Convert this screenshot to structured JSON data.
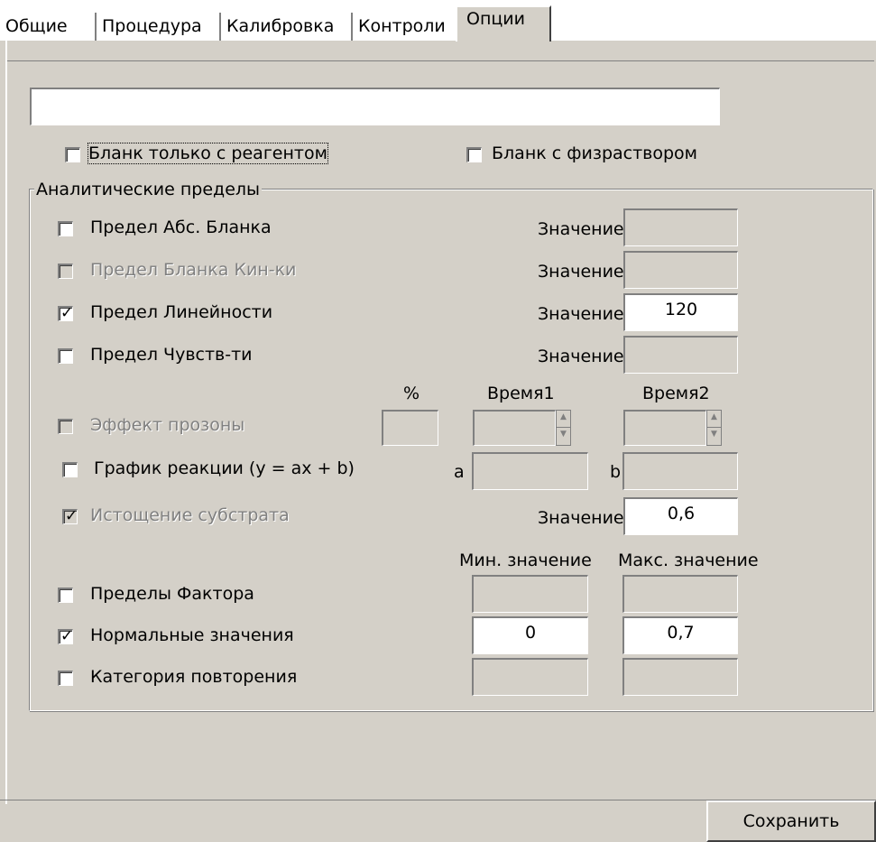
{
  "tabs": [
    "Общие",
    "Процедура",
    "Калибровка",
    "Контроли",
    "Опции"
  ],
  "name_field": {
    "value": ""
  },
  "blank_reagent": {
    "label": "Бланк только с реагентом",
    "checked": false
  },
  "blank_saline": {
    "label": "Бланк с физраствором",
    "checked": false
  },
  "group_title": "Аналитические пределы",
  "value_label": "Значение",
  "rows": {
    "abs_blank": {
      "label": "Предел Абс. Бланка",
      "checked": false,
      "value": ""
    },
    "kin_blank": {
      "label": "Предел Бланка Кин-ки",
      "checked": false,
      "value": ""
    },
    "linearity": {
      "label": "Предел Линейности",
      "checked": true,
      "value": "120"
    },
    "sensitivity": {
      "label": "Предел Чувств-ти",
      "checked": false,
      "value": ""
    }
  },
  "prozone": {
    "label": "Эффект прозоны",
    "checked": false,
    "percent_header": "%",
    "time1_header": "Время1",
    "time2_header": "Время2",
    "percent": "",
    "time1": "",
    "time2": ""
  },
  "reaction_graph": {
    "label": "График реакции (y = ax + b)",
    "checked": false,
    "a_label": "a",
    "b_label": "b",
    "a": "",
    "b": ""
  },
  "substrate": {
    "label": "Истощение субстрата",
    "checked": true,
    "value": "0,6"
  },
  "min_header": "Мин. значение",
  "max_header": "Макс. значение",
  "factor_limits": {
    "label": "Пределы Фактора",
    "checked": false,
    "min": "",
    "max": ""
  },
  "normal_values": {
    "label": "Нормальные значения",
    "checked": true,
    "min": "0",
    "max": "0,7"
  },
  "repeat_category": {
    "label": "Категория повторения",
    "checked": false,
    "min": "",
    "max": ""
  },
  "save_label": "Сохранить"
}
